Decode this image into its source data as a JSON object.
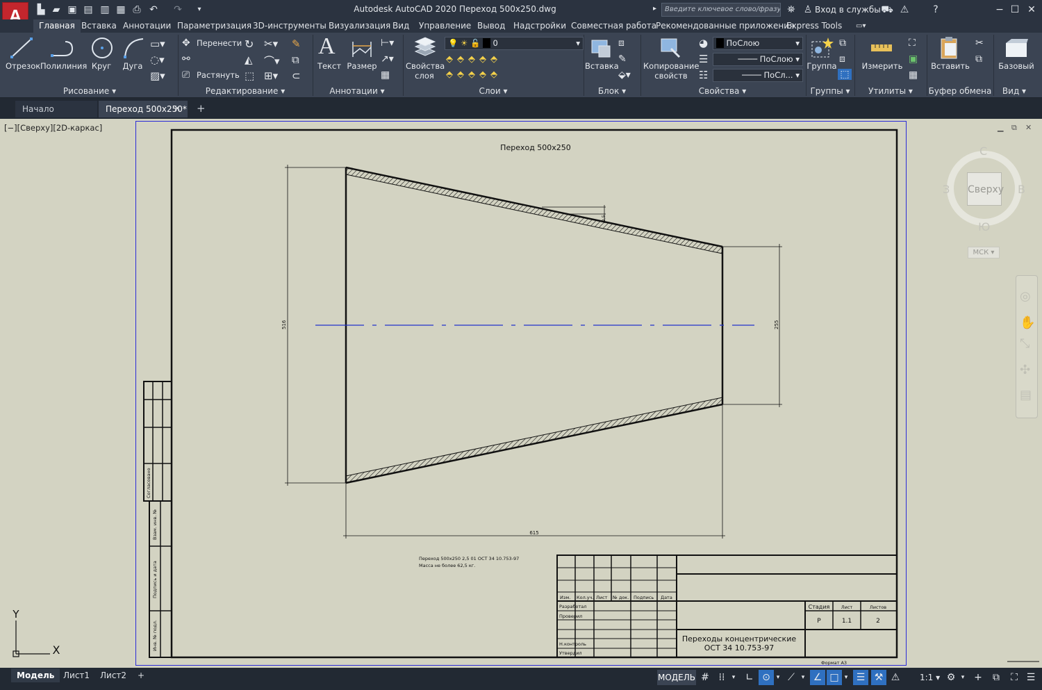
{
  "app": {
    "logo": "A",
    "title": "Autodesk AutoCAD 2020    Переход 500x250.dwg",
    "search_placeholder": "Введите ключевое слово/фразу",
    "signin": "Вход в службы"
  },
  "ribbon_tabs": [
    "Главная",
    "Вставка",
    "Аннотации",
    "Параметризация",
    "3D-инструменты",
    "Визуализация",
    "Вид",
    "Управление",
    "Вывод",
    "Надстройки",
    "Совместная работа",
    "Рекомендованные приложения",
    "Express Tools"
  ],
  "ribbon": {
    "draw": {
      "title": "Рисование",
      "line": "Отрезок",
      "polyline": "Полилиния",
      "circle": "Круг",
      "arc": "Дуга"
    },
    "modify": {
      "title": "Редактирование",
      "move": "Перенести",
      "stretch": "Растянуть"
    },
    "annotation": {
      "title": "Аннотации",
      "text": "Текст",
      "dimension": "Размер"
    },
    "layers": {
      "title": "Слои",
      "props": "Свойства слоя",
      "current_layer": "0"
    },
    "block": {
      "title": "Блок",
      "insert": "Вставка"
    },
    "properties": {
      "title": "Свойства",
      "match": "Копирование свойств",
      "color": "ПоСлою",
      "linetype": "ПоСлою",
      "lineweight": "ПоСл..."
    },
    "groups": {
      "title": "Группы",
      "group": "Группа"
    },
    "utilities": {
      "title": "Утилиты",
      "measure": "Измерить"
    },
    "clipboard": {
      "title": "Буфер обмена",
      "paste": "Вставить"
    },
    "view": {
      "title": "Вид",
      "base": "Базовый"
    }
  },
  "doc_tabs": {
    "start": "Начало",
    "active": "Переход 500x250*"
  },
  "viewport_label": "[−][Сверху][2D-каркас]",
  "viewcube": {
    "face": "Сверху",
    "n": "С",
    "s": "Ю",
    "w": "З",
    "e": "В",
    "ucs": "МСК"
  },
  "drawing": {
    "title": "Переход 500x250",
    "dim_left": "516",
    "dim_right": "255",
    "dim_bottom": "615",
    "dim_small": "2,5",
    "note_line1": "Переход 500x250 2,5 01 ОСТ 34 10.753-97",
    "note_line2": "Масса не более 62,5 кг.",
    "side_labels": [
      "Согласовано",
      "Взам. инв. №",
      "Подпись и дата",
      "Инв. № подл."
    ],
    "ucs_y": "Y",
    "ucs_x": "X"
  },
  "title_block": {
    "cols": [
      "Изм.",
      "Кол.уч.",
      "Лист",
      "№ док.",
      "Подпись",
      "Дата"
    ],
    "rows": [
      "Разработал",
      "Проверил",
      "",
      "Н.контроль",
      "Утвердил"
    ],
    "stage_hdr": "Стадия",
    "sheet_hdr": "Лист",
    "sheets_hdr": "Листов",
    "stage": "Р",
    "sheet": "1.1",
    "sheets": "2",
    "name_line1": "Переходы концентрические",
    "name_line2": "ОСТ 34 10.753-97",
    "format": "Формат А3"
  },
  "layout_tabs": [
    "Модель",
    "Лист1",
    "Лист2"
  ],
  "status": {
    "model": "МОДЕЛЬ",
    "scale": "1:1"
  }
}
